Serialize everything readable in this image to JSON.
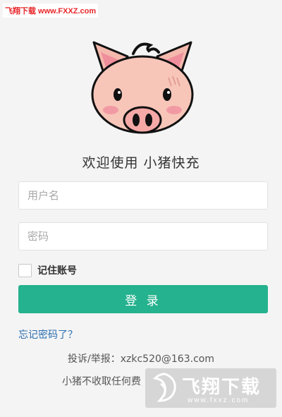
{
  "watermark_top": "飞翔下载 www.FXXZ.com",
  "welcome": "欢迎使用 小猪快充",
  "username": {
    "placeholder": "用户名",
    "value": ""
  },
  "password": {
    "placeholder": "密码",
    "value": ""
  },
  "remember": {
    "label": "记住账号",
    "checked": false
  },
  "login_button": "登 录",
  "forgot_link": "忘记密码了？",
  "complaint": "投诉/举报：xzkc520@163.com",
  "notice": "小猪不收取任何费",
  "watermark_bottom": {
    "title": "飞翔下载",
    "url": "www.fxxz.com"
  },
  "colors": {
    "accent": "#25b28e",
    "link": "#2a6eb0",
    "watermark_red": "#e8262a"
  },
  "icons": {
    "logo": "pig-face-icon",
    "remember": "checkbox-icon"
  }
}
